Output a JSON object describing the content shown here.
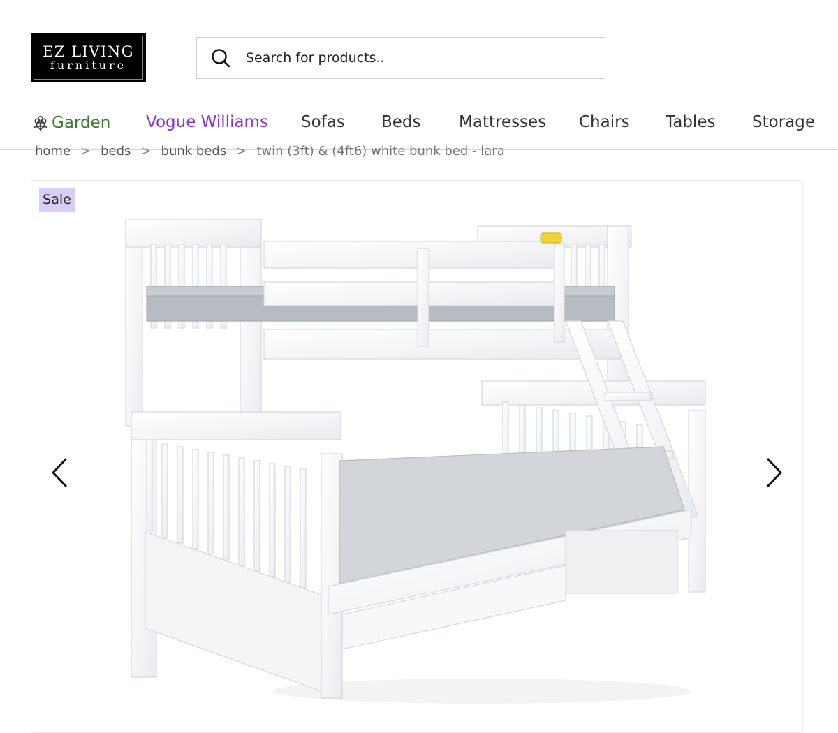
{
  "brand": {
    "line1": "EZ LIVING",
    "line2": "furniture"
  },
  "search": {
    "placeholder": "Search for products.."
  },
  "nav": {
    "items": [
      {
        "label": "Garden",
        "color": "#3e7a2e"
      },
      {
        "label": "Vogue Williams",
        "color": "#8a36c9"
      },
      {
        "label": "Sofas"
      },
      {
        "label": "Beds"
      },
      {
        "label": "Mattresses"
      },
      {
        "label": "Chairs"
      },
      {
        "label": "Tables"
      },
      {
        "label": "Storage"
      }
    ]
  },
  "breadcrumb": {
    "items": [
      "home",
      "beds",
      "bunk beds"
    ],
    "separator": ">",
    "current": "twin (3ft) & (4ft6) white bunk bed - lara"
  },
  "product": {
    "badge": "Sale",
    "image_icon": "white-bunk-bed-image",
    "accent_badge_color": "#d9cdf7"
  },
  "carousel": {
    "prev_icon": "chevron-left-icon",
    "next_icon": "chevron-right-icon"
  }
}
